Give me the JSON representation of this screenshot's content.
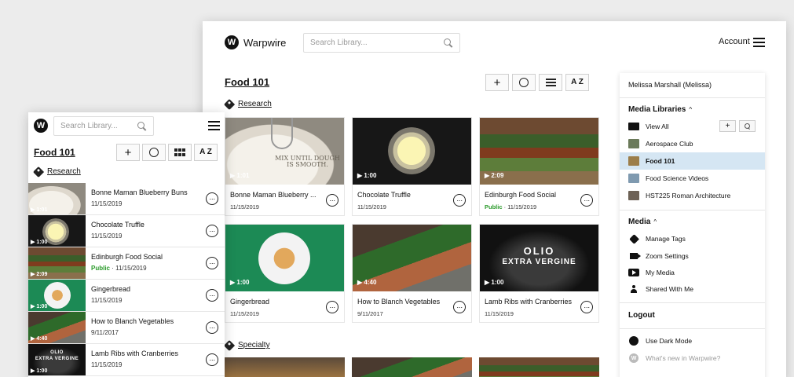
{
  "app": {
    "name": "Warpwire",
    "logo_letter": "W"
  },
  "header": {
    "search_placeholder": "Search Library...",
    "account_label": "Account"
  },
  "library": {
    "title": "Food 101",
    "tag_research": "Research",
    "tag_specialty": "Specialty"
  },
  "toolbar": {
    "add": "+",
    "az": "A Z"
  },
  "videos": [
    {
      "title": "Bonne Maman Blueberry Buns",
      "title_short": "Bonne Maman Blueberry ...",
      "date": "11/15/2019",
      "duration": "1:01",
      "public": "",
      "art": "MIX UNTIL DOUGH IS SMOOTH."
    },
    {
      "title": "Chocolate Truffle",
      "date": "11/15/2019",
      "duration": "1:00",
      "public": ""
    },
    {
      "title": "Edinburgh Food Social",
      "date": "11/15/2019",
      "duration": "2:09",
      "public": "Public"
    },
    {
      "title": "Gingerbread",
      "date": "11/15/2019",
      "duration": "1:00",
      "public": ""
    },
    {
      "title": "How to Blanch Vegetables",
      "date": "9/11/2017",
      "duration": "4:40",
      "public": ""
    },
    {
      "title": "Lamb Ribs with Cranberries",
      "date": "11/15/2019",
      "duration": "1:00",
      "public": "",
      "art_line1": "OLIO",
      "art_line2": "EXTRA VERGINE"
    }
  ],
  "meta_separator": " · ",
  "more_glyph": "···",
  "sidebar": {
    "user": "Melissa Marshall (Melissa)",
    "media_libraries": "Media Libraries",
    "chevron": "^",
    "libraries": [
      {
        "label": "View All",
        "color": "#111"
      },
      {
        "label": "Aerospace Club",
        "color": "#6b7a5a"
      },
      {
        "label": "Food 101",
        "color": "#9c7e4a"
      },
      {
        "label": "Food Science Videos",
        "color": "#7f9ab0"
      },
      {
        "label": "HST225 Roman Architecture",
        "color": "#6d6256"
      }
    ],
    "add_glyph": "+",
    "media": "Media",
    "media_items": [
      "Manage Tags",
      "Zoom Settings",
      "My Media",
      "Shared With Me"
    ],
    "logout": "Logout",
    "dark_mode": "Use Dark Mode",
    "whats_new": "What's new in Warpwire?"
  },
  "colors": {
    "public_green": "#2a9a2a",
    "active_row": "#d5e6f3",
    "ginger_bg": "#1c8a55"
  }
}
